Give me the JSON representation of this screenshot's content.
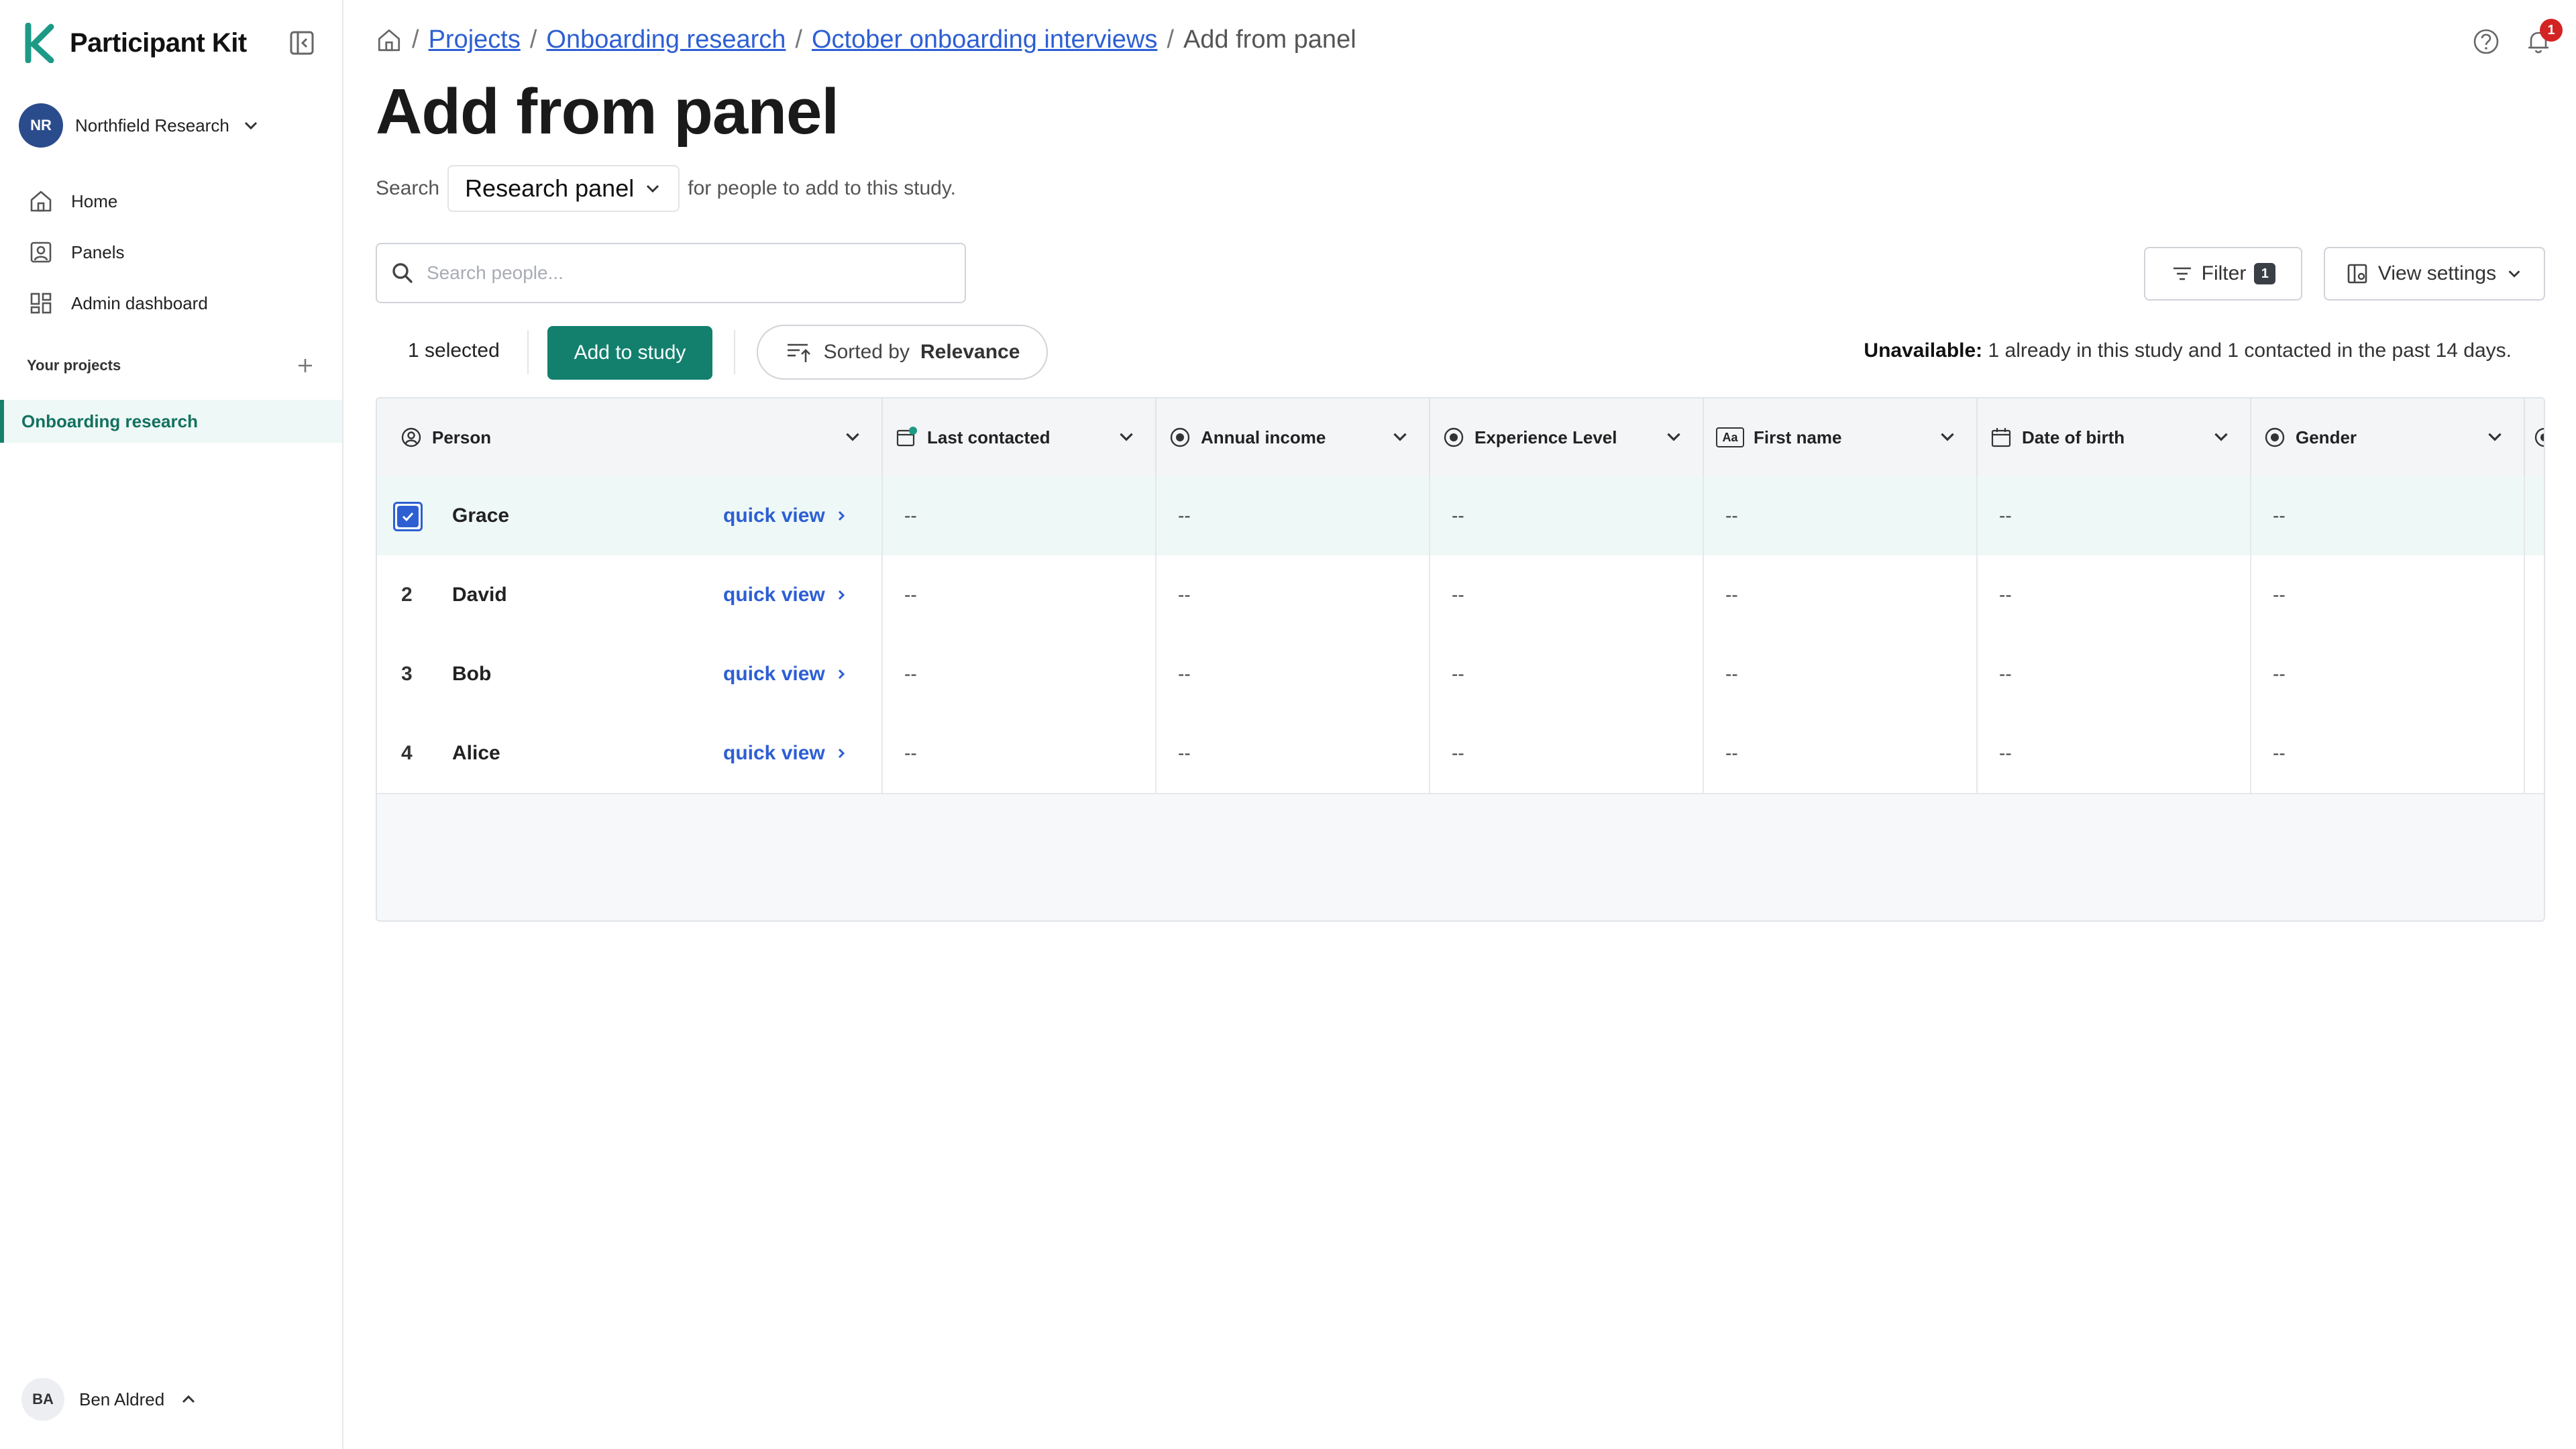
{
  "app": {
    "name": "Participant Kit",
    "accent": "#13806e",
    "link_color": "#2d5fd3"
  },
  "sidebar": {
    "org": {
      "initials": "NR",
      "name": "Northfield Research"
    },
    "nav": [
      {
        "label": "Home",
        "icon": "home-icon"
      },
      {
        "label": "Panels",
        "icon": "panels-icon"
      },
      {
        "label": "Admin dashboard",
        "icon": "dashboard-icon"
      }
    ],
    "projects_label": "Your projects",
    "projects": [
      {
        "label": "Onboarding research",
        "active": true
      }
    ],
    "user": {
      "initials": "BA",
      "name": "Ben Aldred"
    }
  },
  "breadcrumb": {
    "items": [
      "Projects",
      "Onboarding research",
      "October onboarding interviews"
    ],
    "current": "Add from panel"
  },
  "header": {
    "notification_count": "1"
  },
  "page": {
    "title": "Add from panel",
    "search_prefix": "Search",
    "panel_selected": "Research panel",
    "search_suffix": "for people to add to this study."
  },
  "search": {
    "placeholder": "Search people..."
  },
  "toolbar": {
    "filter_label": "Filter",
    "filter_count": "1",
    "view_label": "View settings",
    "selected_text": "1 selected",
    "add_label": "Add to study",
    "sort_prefix": "Sorted by",
    "sort_value": "Relevance",
    "unavailable_label": "Unavailable:",
    "unavailable_text": "1 already in this study and 1 contacted in the past 14 days."
  },
  "table": {
    "columns": [
      {
        "label": "Person",
        "icon": "person-icon"
      },
      {
        "label": "Last contacted",
        "icon": "calendar-clock-icon"
      },
      {
        "label": "Annual income",
        "icon": "radio-icon"
      },
      {
        "label": "Experience Level",
        "icon": "radio-icon"
      },
      {
        "label": "First name",
        "icon": "text-icon",
        "icon_text": "Aa"
      },
      {
        "label": "Date of birth",
        "icon": "calendar-icon"
      },
      {
        "label": "Gender",
        "icon": "radio-icon"
      }
    ],
    "rows": [
      {
        "num": "",
        "name": "Grace",
        "selected": true,
        "link": "quick view",
        "cells": [
          "--",
          "--",
          "--",
          "--",
          "--",
          "--",
          "-"
        ]
      },
      {
        "num": "2",
        "name": "David",
        "selected": false,
        "link": "quick view",
        "cells": [
          "--",
          "--",
          "--",
          "--",
          "--",
          "--",
          "-"
        ]
      },
      {
        "num": "3",
        "name": "Bob",
        "selected": false,
        "link": "quick view",
        "cells": [
          "--",
          "--",
          "--",
          "--",
          "--",
          "--",
          "-"
        ]
      },
      {
        "num": "4",
        "name": "Alice",
        "selected": false,
        "link": "quick view",
        "cells": [
          "--",
          "--",
          "--",
          "--",
          "--",
          "--",
          "-"
        ]
      }
    ]
  }
}
